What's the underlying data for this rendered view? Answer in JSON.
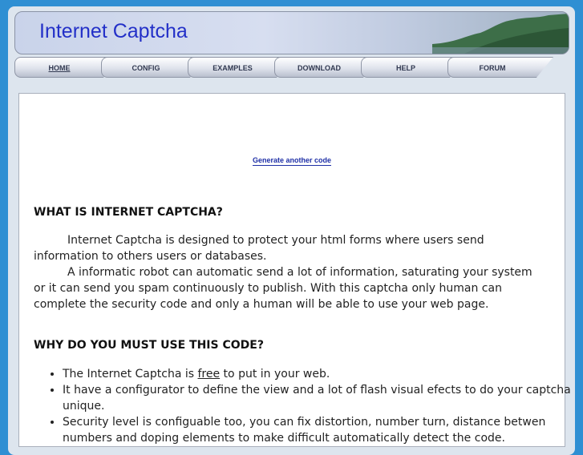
{
  "header": {
    "title": "Internet Captcha"
  },
  "nav": {
    "tabs": [
      {
        "label": "HOME"
      },
      {
        "label": "CONFIG"
      },
      {
        "label": "EXAMPLES"
      },
      {
        "label": "DOWNLOAD"
      },
      {
        "label": "HELP"
      },
      {
        "label": "FORUM"
      }
    ],
    "active": "HOME"
  },
  "content": {
    "generate_link": "Generate another code",
    "section1_title": "WHAT IS INTERNET CAPTCHA?",
    "para1": "Internet Captcha is designed to protect your html forms where users send information to others users or databases.",
    "para2": "A informatic robot can automatic send a lot of information, saturating your system or it can send you spam continuously to publish. With this captcha only human can complete the security code and only a human will be able to use your web page.",
    "section2_title": "WHY DO YOU MUST USE THIS CODE?",
    "bullets": [
      {
        "pre": "The Internet Captcha is ",
        "link": "free",
        "post": " to put in your web."
      },
      {
        "text": "It have a configurator to define the view and a lot of flash visual efects to do your captcha unique."
      },
      {
        "text": "Security level is configuable too, you can fix distortion, number turn, distance betwen numbers and doping elements to make difficult automatically detect the code."
      }
    ]
  }
}
